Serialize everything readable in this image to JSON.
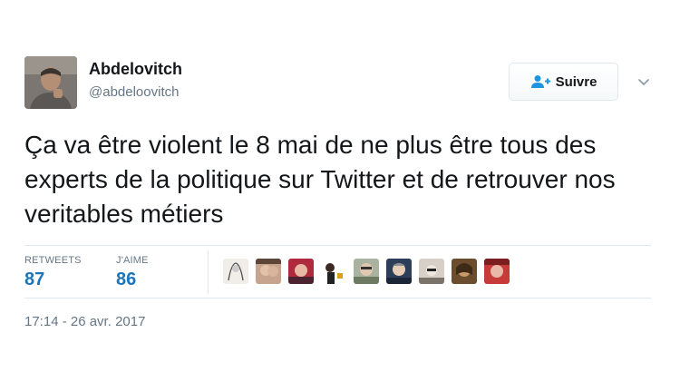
{
  "author": {
    "name": "Abdelovitch",
    "handle": "@abdeloovitch"
  },
  "follow_button": {
    "label": "Suivre",
    "icon": "add-user-icon"
  },
  "menu_icon": "chevron-down-icon",
  "tweet": {
    "text": "Ça va être violent le 8 mai de ne plus être tous des experts de la politique sur Twitter et de retrouver nos veritables métiers"
  },
  "stats": {
    "retweets_label": "RETWEETS",
    "retweets_count": "87",
    "likes_label": "J'AIME",
    "likes_count": "86"
  },
  "likers_count": 9,
  "timestamp": "17:14 - 26 avr. 2017",
  "colors": {
    "accent": "#1b75bb",
    "muted": "#657786",
    "text": "#14171a",
    "border": "#e1e8ed"
  }
}
